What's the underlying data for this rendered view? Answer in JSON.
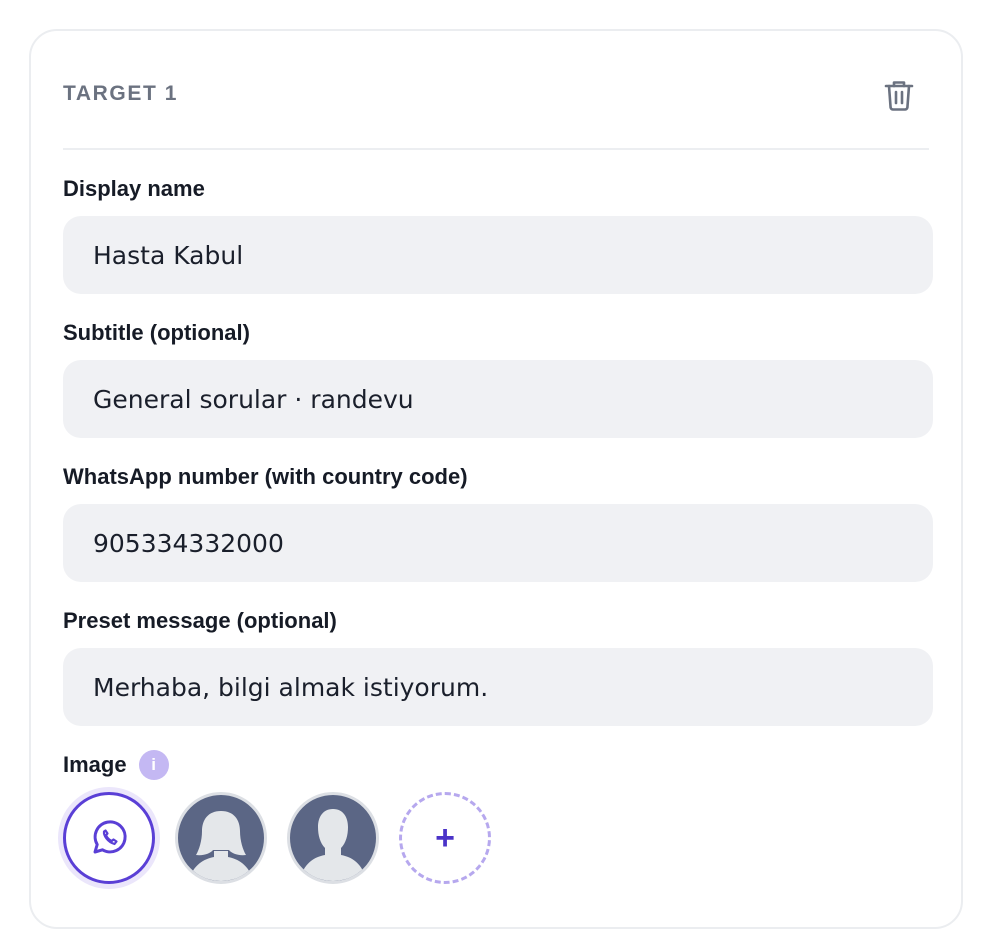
{
  "target": {
    "title": "TARGET 1",
    "delete_icon": "trash-icon"
  },
  "fields": {
    "display_name": {
      "label": "Display name",
      "value": "Hasta Kabul"
    },
    "subtitle": {
      "label": "Subtitle (optional)",
      "value": "General sorular · randevu"
    },
    "whatsapp_number": {
      "label": "WhatsApp number (with country code)",
      "value": "905334332000"
    },
    "preset_message": {
      "label": "Preset message (optional)",
      "value": "Merhaba, bilgi almak istiyorum."
    }
  },
  "image": {
    "label": "Image",
    "info_icon": "i",
    "options": [
      {
        "icon": "whatsapp-icon",
        "selected": true
      },
      {
        "icon": "female-avatar-icon",
        "selected": false
      },
      {
        "icon": "male-avatar-icon",
        "selected": false
      }
    ],
    "add_symbol": "+"
  },
  "colors": {
    "accent": "#5a3fd6",
    "accent_light": "#c4b8f3",
    "input_bg": "#f0f1f4",
    "avatar_bg": "#5b6685"
  }
}
